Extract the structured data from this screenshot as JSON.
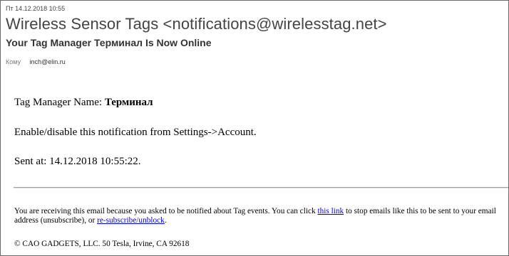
{
  "email": {
    "date": "Пт 14.12.2018 10:55",
    "sender": "Wireless Sensor Tags <notifications@wirelesstag.net>",
    "subject": "Your Tag Manager Терминал Is Now Online",
    "to_label": "Кому",
    "to_address": "inch@elin.ru"
  },
  "body": {
    "manager_label": "Tag Manager Name: ",
    "manager_name": "Терминал",
    "settings_line": "Enable/disable this notification from Settings->Account.",
    "sent_at": "Sent at: 14.12.2018 10:55:22."
  },
  "footer": {
    "text_before_link": "You are receiving this email because you asked to be notified about Tag events. You can click ",
    "link1_text": "this link",
    "text_middle": " to stop emails like this to be sent to your email address (unsubscribe), or ",
    "link2_text": "re-subscribe/unblock",
    "text_end": ".",
    "copyright": "© CAO GADGETS, LLC. 50 Tesla, Irvine, CA 92618"
  }
}
